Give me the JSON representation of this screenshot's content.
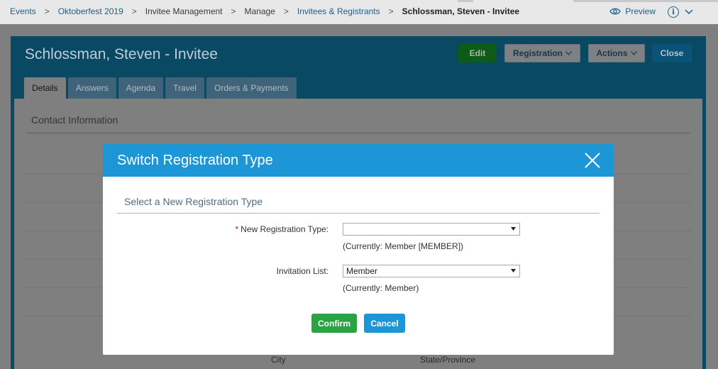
{
  "breadcrumb": {
    "items": [
      "Events",
      "Oktoberfest 2019",
      "Invitee Management",
      "Manage",
      "Invitees & Registrants",
      "Schlossman, Steven - Invitee"
    ],
    "separator": ">"
  },
  "top_right": {
    "preview_label": "Preview"
  },
  "header": {
    "title": "Schlossman, Steven - Invitee",
    "edit_label": "Edit",
    "registration_label": "Registration",
    "actions_label": "Actions",
    "close_label": "Close"
  },
  "tabs": [
    {
      "label": "Details",
      "active": true
    },
    {
      "label": "Answers"
    },
    {
      "label": "Agenda"
    },
    {
      "label": "Travel"
    },
    {
      "label": "Orders & Payments"
    }
  ],
  "content": {
    "section_title": "Contact Information",
    "city_label": "City",
    "state_label": "State/Province"
  },
  "modal": {
    "title": "Switch Registration Type",
    "subtitle": "Select a New Registration Type",
    "new_type": {
      "label": "New Registration Type:",
      "required_mark": "*",
      "value": "",
      "currently": "(Currently: Member [MEMBER])"
    },
    "invitation_list": {
      "label": "Invitation List:",
      "value": "Member",
      "currently": "(Currently: Member)"
    },
    "confirm_label": "Confirm",
    "cancel_label": "Cancel"
  },
  "colors": {
    "modal_header": "#1d96d7",
    "confirm": "#2aa443",
    "cancel": "#1d96d7",
    "panel_header_dimmed": "#0a4964"
  }
}
